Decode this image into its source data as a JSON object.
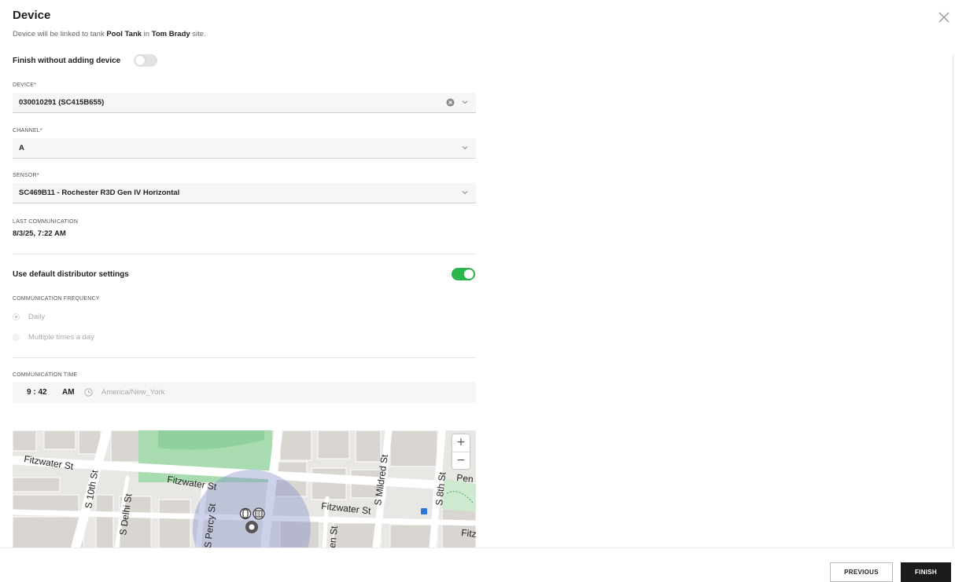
{
  "header": {
    "title": "Device",
    "subtitle_prefix": "Device will be linked to tank ",
    "tank_name": "Pool Tank",
    "subtitle_middle": " in ",
    "site_name": "Tom Brady",
    "subtitle_suffix": " site."
  },
  "finish_without_device": {
    "label": "Finish without adding device",
    "checked": false
  },
  "device": {
    "label": "DEVICE*",
    "value": "030010291 (SC415B655)"
  },
  "channel": {
    "label": "CHANNEL*",
    "value": "A"
  },
  "sensor": {
    "label": "SENSOR*",
    "value": "SC469B11 - Rochester R3D Gen IV Horizontal"
  },
  "last_communication": {
    "label": "LAST COMMUNICATION",
    "value": "8/3/25, 7:22 AM"
  },
  "distributor_settings": {
    "label": "Use default distributor settings",
    "checked": true
  },
  "frequency": {
    "label": "COMMUNICATION FREQUENCY",
    "options": [
      {
        "label": "Daily",
        "selected": true
      },
      {
        "label": "Multiple times a day",
        "selected": false
      }
    ]
  },
  "comm_time": {
    "label": "COMMUNICATION TIME",
    "hours": "9",
    "minutes": "42",
    "ampm": "AM",
    "timezone": "America/New_York"
  },
  "map": {
    "streets": [
      "Fitzwater St",
      "Fitzwater St",
      "Fitzwater St",
      "S 10th St",
      "S Delhi St",
      "S Percy St",
      "S Mildred St",
      "S 8th St",
      "Fitz",
      "Pen",
      "en St"
    ],
    "zoom_in": "+",
    "zoom_out": "−"
  },
  "footer": {
    "previous_label": "PREVIOUS",
    "finish_label": "FINISH"
  },
  "colors": {
    "accent_green": "#2bb44a",
    "primary_button": "#1b1b1b"
  }
}
